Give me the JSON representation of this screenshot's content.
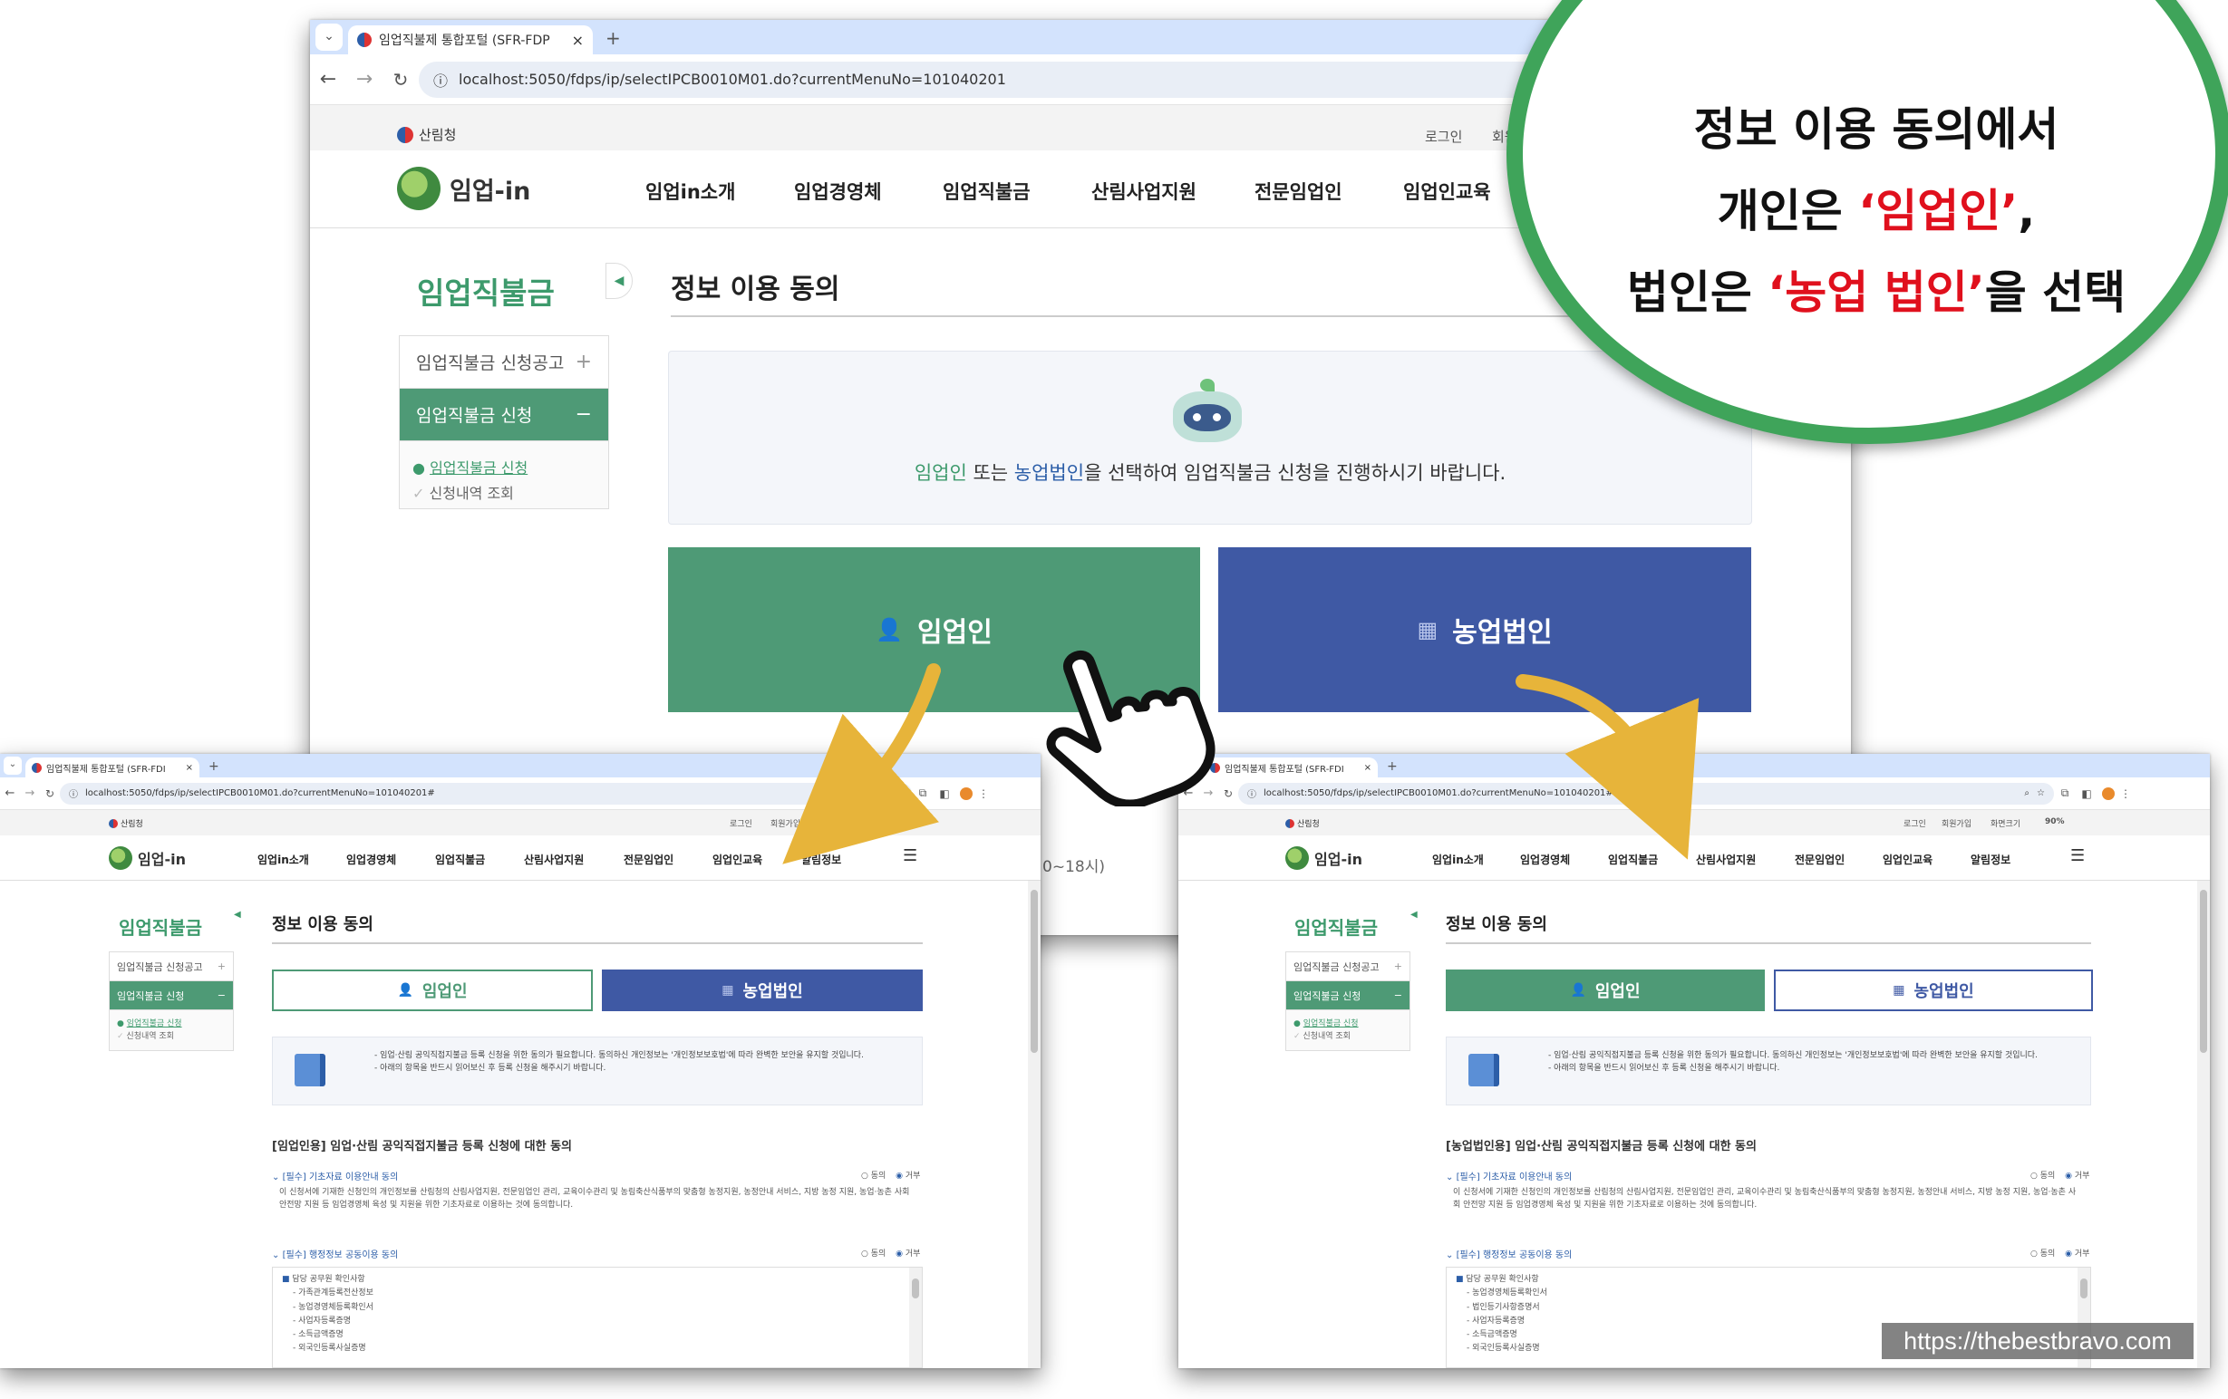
{
  "browser": {
    "tab_title": "임업직불제 통합포털 (SFR-FDP",
    "tab_title_short": "임업직불제 통합포털 (SFR-FDI",
    "new_tab": "+",
    "tab_close": "×",
    "url_main": "localhost:5050/fdps/ip/selectIPCB0010M01.do?currentMenuNo=101040201",
    "url_left": "localhost:5050/fdps/ip/selectIPCB0010M01.do?currentMenuNo=101040201#",
    "url_right": "localhost:5050/fdps/ip/selectIPCB0010M01.do?currentMenuNo=101040201#",
    "zoom": "90%"
  },
  "site": {
    "agency": "산림청",
    "logo": "임업-in",
    "top_links": {
      "login": "로그인",
      "signup": "회원가입",
      "signup_cut": "회원가",
      "font_size": "화면크기"
    },
    "menu": [
      "임업in소개",
      "임업경영체",
      "임업직불금",
      "산림사업지원",
      "전문임업인",
      "임업인교육",
      "알림정보"
    ]
  },
  "sidebar": {
    "title": "임업직불금",
    "items": [
      {
        "label": "임업직불금 신청공고",
        "sign": "+"
      },
      {
        "label": "임업직불금 신청",
        "sign": "−"
      }
    ],
    "sub": [
      {
        "label": "임업직불금 신청"
      },
      {
        "label": "신청내역 조회"
      }
    ]
  },
  "main": {
    "title": "정보 이용 동의",
    "info_pre": "임업인",
    "info_mid": " 또는 ",
    "info_link": "농업법인",
    "info_post": "을 선택하여 임업직불금 신청을 진행하시기 바랍니다.",
    "btn_person": "임업인",
    "btn_corp": "농업법인",
    "partial_hours": "0~18시)"
  },
  "consent": {
    "notice1": "- 임업·산림 공익직접지불금 등록 신청을 위한 동의가 필요합니다. 동의하신 개인정보는 '개인정보보호법'에 따라 완벽한 보안을 유지할 것입니다.",
    "notice2": "- 아래의 항목을 반드시 읽어보신 후 등록 신청을 해주시기 바랍니다.",
    "section_person": "[임업인용] 임업·산림 공익직접지불금 등록 신청에 대한 동의",
    "section_corp": "[농업법인용] 임업·산림 공익직접지불금 등록 신청에 대한 동의",
    "item1": "[필수] 기초자료 이용안내 동의",
    "item1_body": "이 신청서에 기재한 신청인의 개인정보를 산림청의 산림사업지원, 전문임업인 관리, 교육이수관리 및 농림축산식품부의 맞춤형 농정지원, 농정안내 서비스, 지방 농정 지원, 농업·농촌 사회 안전망 지원 등 임업경영체 육성 및 지원을 위한 기초자료로 이용하는 것에 동의합니다.",
    "item2": "[필수] 행정정보 공동이용 동의",
    "agree": "동의",
    "disagree": "거부",
    "officer": "담당 공무원 확인사항",
    "list_person": [
      "가족관계등록전산정보",
      "농업경영체등록확인서",
      "사업자등록증명",
      "소득금액증명",
      "외국인등록사실증명"
    ],
    "list_corp": [
      "농업경영체등록확인서",
      "법인등기사항증명서",
      "사업자등록증명",
      "소득금액증명",
      "외국인등록사실증명"
    ]
  },
  "callout": {
    "line1": "정보 이용 동의에서",
    "line2_pre": "개인은 ",
    "line2_hl": "‘임업인’",
    "line2_post": ",",
    "line3_pre": "법인은 ",
    "line3_hl": "‘농업 법인’",
    "line3_post": "을 선택"
  },
  "watermark": "https://thebestbravo.com",
  "colors": {
    "green": "#4e9a76",
    "blue": "#3f59a4",
    "highlight": "#e0101d",
    "arrow": "#e7b43a"
  }
}
